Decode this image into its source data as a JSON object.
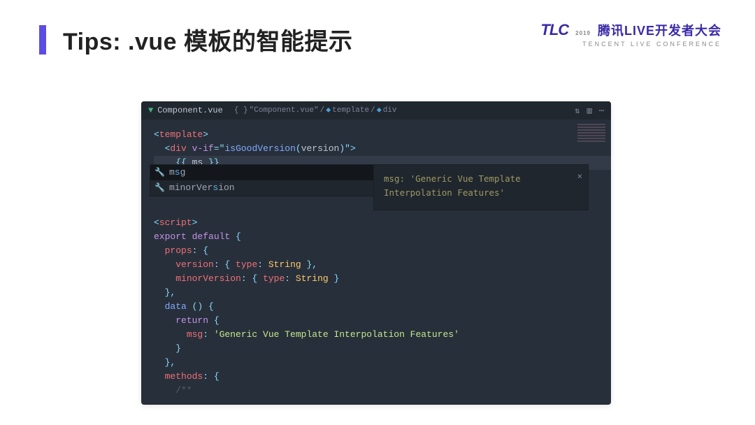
{
  "header": {
    "title": "Tips: .vue 模板的智能提示",
    "logo_brand": "TLC",
    "logo_year": "2019",
    "logo_cn": "腾讯LIVE开发者大会",
    "logo_en": "TENCENT LIVE CONFERENCE"
  },
  "tab": {
    "filename": "Component.vue",
    "crumb1": "\"Component.vue\"",
    "crumb2": "template",
    "crumb3": "div"
  },
  "code": {
    "l1a": "<",
    "l1b": "template",
    "l1c": ">",
    "l2a": "  <",
    "l2b": "div",
    "l2c": " ",
    "l2d": "v-if",
    "l2e": "=",
    "l2f": "\"",
    "l2g": "isGoodVersion",
    "l2h": "(",
    "l2i": "version",
    "l2j": ")",
    "l2k": "\"",
    "l2l": ">",
    "l3a": "    {{ ",
    "l3b": "ms",
    "l3c": " }}",
    "l5a": "<",
    "l5b": "script",
    "l5c": ">",
    "l6a": "export",
    "l6b": " default ",
    "l6c": "{",
    "l7a": "  ",
    "l7b": "props",
    "l7c": ": {",
    "l8a": "    ",
    "l8b": "version",
    "l8c": ": { ",
    "l8d": "type",
    "l8e": ": ",
    "l8f": "String",
    "l8g": " },",
    "l9a": "    ",
    "l9b": "minorVersion",
    "l9c": ": { ",
    "l9d": "type",
    "l9e": ": ",
    "l9f": "String",
    "l9g": " }",
    "l10a": "  },",
    "l11a": "  ",
    "l11b": "data",
    "l11c": " () {",
    "l12a": "    ",
    "l12b": "return",
    "l12c": " {",
    "l13a": "      ",
    "l13b": "msg",
    "l13c": ": ",
    "l13d": "'Generic Vue Template Interpolation Features'",
    "l14a": "    }",
    "l15a": "  },",
    "l16a": "  ",
    "l16b": "methods",
    "l16c": ": {",
    "l17a": "    /**"
  },
  "autocomplete": {
    "item1_pre": "m",
    "item1_match": "s",
    "item1_post": "g",
    "item2_pre": "minorVer",
    "item2_match": "s",
    "item2_post": "ion"
  },
  "docpop": {
    "text": "msg: 'Generic Vue Template Interpolation Features'"
  }
}
